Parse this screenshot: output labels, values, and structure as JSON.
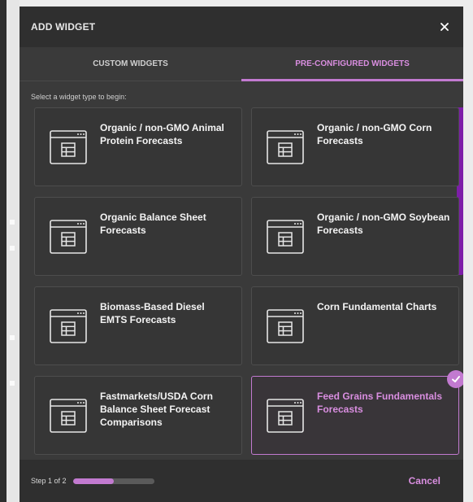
{
  "modal": {
    "title": "ADD WIDGET",
    "close_icon": "close-icon"
  },
  "tabs": [
    {
      "label": "CUSTOM WIDGETS",
      "active": false
    },
    {
      "label": "PRE-CONFIGURED WIDGETS",
      "active": true
    }
  ],
  "prompt": "Select a widget type to begin:",
  "widgets": [
    {
      "label": "Organic / non-GMO Animal Protein Forecasts",
      "icon": "table-window-icon",
      "selected": false
    },
    {
      "label": "Organic / non-GMO Corn Forecasts",
      "icon": "table-window-icon",
      "selected": false
    },
    {
      "label": "Organic Balance Sheet Forecasts",
      "icon": "table-window-icon",
      "selected": false
    },
    {
      "label": "Organic / non-GMO Soybean Forecasts",
      "icon": "table-window-icon",
      "selected": false
    },
    {
      "label": "Biomass-Based Diesel EMTS Forecasts",
      "icon": "table-window-icon",
      "selected": false
    },
    {
      "label": "Corn Fundamental Charts",
      "icon": "table-window-icon",
      "selected": false
    },
    {
      "label": "Fastmarkets/USDA Corn Balance Sheet Forecast Comparisons",
      "icon": "table-window-icon",
      "selected": false
    },
    {
      "label": "Feed Grains Fundamentals Forecasts",
      "icon": "table-window-icon",
      "selected": true
    }
  ],
  "footer": {
    "step_label": "Step 1 of 2",
    "progress": 0.5,
    "cancel_label": "Cancel"
  },
  "colors": {
    "accent": "#c27ad0",
    "accent_text": "#d98ee0",
    "scrollbar": "#7d1ea8",
    "modal_bg": "#3a3a3a",
    "header_bg": "#2f2f2f"
  }
}
